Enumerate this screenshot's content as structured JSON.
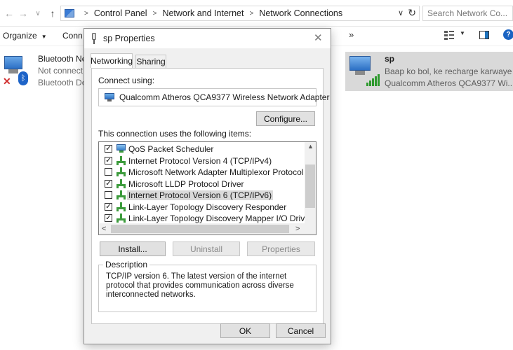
{
  "explorer": {
    "breadcrumb": [
      "Control Panel",
      "Network and Internet",
      "Network Connections"
    ],
    "search_placeholder": "Search Network Co...",
    "toolbar": {
      "organize": "Organize",
      "connect_partial": "Conn",
      "more": "»"
    }
  },
  "connections": {
    "left": {
      "name": "Bluetooth Ne",
      "status": "Not connect",
      "device": "Bluetooth De"
    },
    "right": {
      "name": "sp",
      "status": "Baap ko bol, ke recharge karwaye",
      "device": "Qualcomm Atheros QCA9377 Wi..."
    }
  },
  "dialog": {
    "title": "sp Properties",
    "tabs": [
      "Networking",
      "Sharing"
    ],
    "connect_using_label": "Connect using:",
    "adapter": "Qualcomm Atheros QCA9377 Wireless Network Adapter",
    "configure_button": "Configure...",
    "items_label": "This connection uses the following items:",
    "items": [
      {
        "label": "QoS Packet Scheduler",
        "checked": true,
        "icon": "network-service-icon"
      },
      {
        "label": "Internet Protocol Version 4 (TCP/IPv4)",
        "checked": true,
        "icon": "protocol-icon"
      },
      {
        "label": "Microsoft Network Adapter Multiplexor Protocol",
        "checked": false,
        "icon": "protocol-icon"
      },
      {
        "label": "Microsoft LLDP Protocol Driver",
        "checked": true,
        "icon": "protocol-icon"
      },
      {
        "label": "Internet Protocol Version 6 (TCP/IPv6)",
        "checked": false,
        "icon": "protocol-icon",
        "selected": true
      },
      {
        "label": "Link-Layer Topology Discovery Responder",
        "checked": true,
        "icon": "protocol-icon"
      },
      {
        "label": "Link-Layer Topology Discovery Mapper I/O Driver",
        "checked": true,
        "icon": "protocol-icon"
      }
    ],
    "buttons": {
      "install": "Install...",
      "uninstall": "Uninstall",
      "properties": "Properties",
      "ok": "OK",
      "cancel": "Cancel"
    },
    "description_label": "Description",
    "description_text": "TCP/IP version 6. The latest version of the internet protocol that provides communication across diverse interconnected networks.",
    "colors": {
      "selection": "#d9d9d9",
      "accent": "#0078d7",
      "protocol_icon": "#3c9b3c"
    }
  }
}
